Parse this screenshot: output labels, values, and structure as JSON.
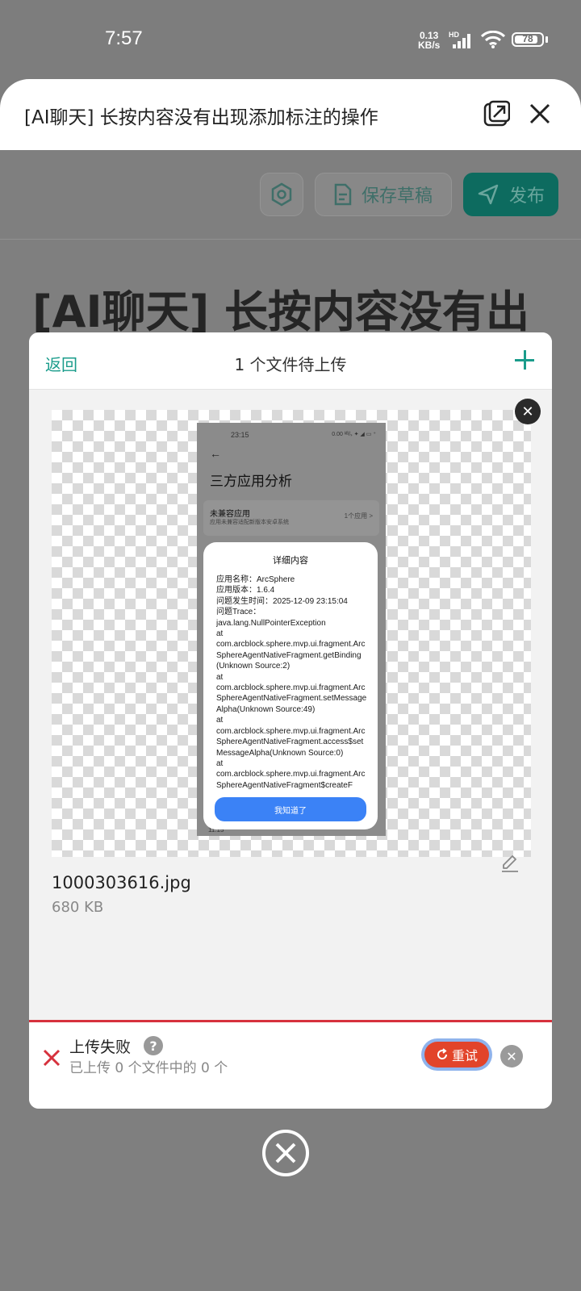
{
  "status_bar": {
    "time": "7:57",
    "net_speed_value": "0.13",
    "net_speed_unit": "KB/s",
    "hd": "HD",
    "battery": "78"
  },
  "header": {
    "title": "[AI聊天] 长按内容没有出现添加标注的操作"
  },
  "toolbar": {
    "draft_label": "保存草稿",
    "publish_label": "发布"
  },
  "editor": {
    "doc_title": "[AI聊天] 长按内容没有出"
  },
  "upload_modal": {
    "back_label": "返回",
    "title": "1 个文件待上传",
    "file": {
      "name": "1000303616.jpg",
      "size": "680 KB"
    },
    "preview": {
      "time": "23:15",
      "status": "0.00 ᵏᴮ/ₛ ✦ ◢ ▭ ⁺",
      "page_title": "三方应用分析",
      "card_title": "未兼容应用",
      "card_sub": "应用未兼容适配新版本安卓系统",
      "card_right": "1个应用 >",
      "footer_time": "11:15",
      "dialog_title": "详细内容",
      "dialog_lines": [
        "应用名称：ArcSphere",
        "应用版本：1.6.4",
        "问题发生时间：2025-12-09 23:15:04",
        "问题Trace：",
        "java.lang.NullPointerException",
        " at",
        "com.arcblock.sphere.mvp.ui.fragment.ArcSphereAgentNativeFragment.getBinding(Unknown Source:2)",
        " at",
        "com.arcblock.sphere.mvp.ui.fragment.ArcSphereAgentNativeFragment.setMessageAlpha(Unknown Source:49)",
        " at",
        "com.arcblock.sphere.mvp.ui.fragment.ArcSphereAgentNativeFragment.access$setMessageAlpha(Unknown Source:0)",
        " at",
        "com.arcblock.sphere.mvp.ui.fragment.ArcSphereAgentNativeFragment$createF"
      ],
      "dialog_button": "我知道了"
    },
    "status": {
      "title": "上传失败",
      "help_glyph": "?",
      "subtitle": "已上传 0 个文件中的 0 个",
      "retry_label": "重试"
    }
  },
  "colors": {
    "accent": "#1a9c8b",
    "error": "#d6313d",
    "retry": "#e2442a"
  }
}
